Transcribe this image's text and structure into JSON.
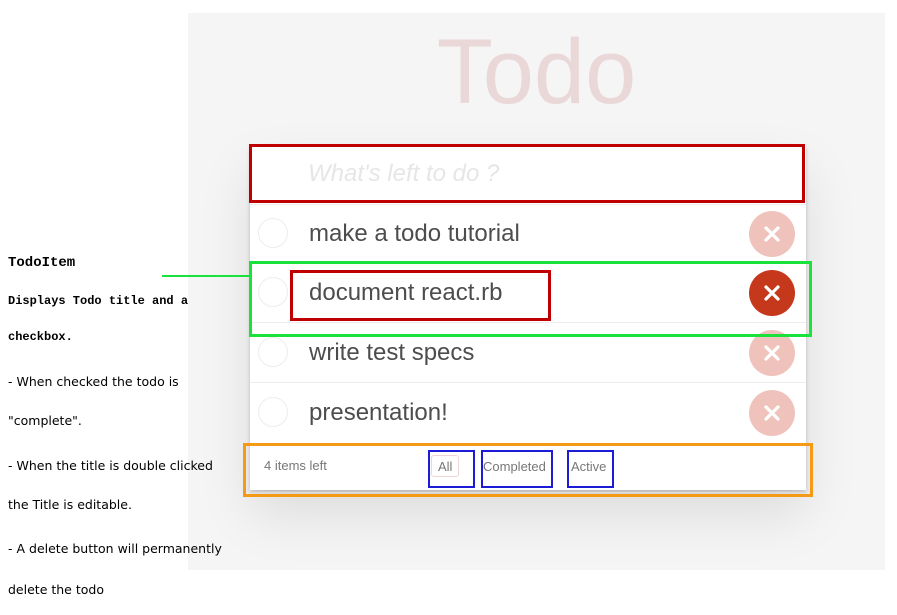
{
  "app": {
    "title": "Todo",
    "new_todo_placeholder": "What's left to do ?",
    "todos": [
      {
        "title": "make a todo tutorial",
        "completed": false
      },
      {
        "title": "document react.rb",
        "completed": false
      },
      {
        "title": "write test specs",
        "completed": false
      },
      {
        "title": "presentation!",
        "completed": false
      }
    ],
    "footer": {
      "count_label": "4 items left",
      "filters": [
        "All",
        "Completed",
        "Active"
      ],
      "selected_filter": "All"
    }
  },
  "annotation": {
    "heading": "TodoItem",
    "description_lines": [
      "Displays Todo title and a",
      "checkbox."
    ],
    "notes": [
      "- When checked the todo is",
      "\"complete\".",
      "- When the title is double clicked",
      "the Title is editable.",
      "- A delete button will permanently",
      "delete the todo"
    ]
  },
  "colors": {
    "annotation_red": "#c00000",
    "annotation_green": "#19e23a",
    "annotation_orange": "#f59a15",
    "annotation_blue": "#1b1bd8",
    "destroy_active": "#c6381c",
    "destroy_faded": "#efc3bb"
  },
  "icons": {
    "checkbox": "circle-outline-icon",
    "delete": "close-icon"
  }
}
